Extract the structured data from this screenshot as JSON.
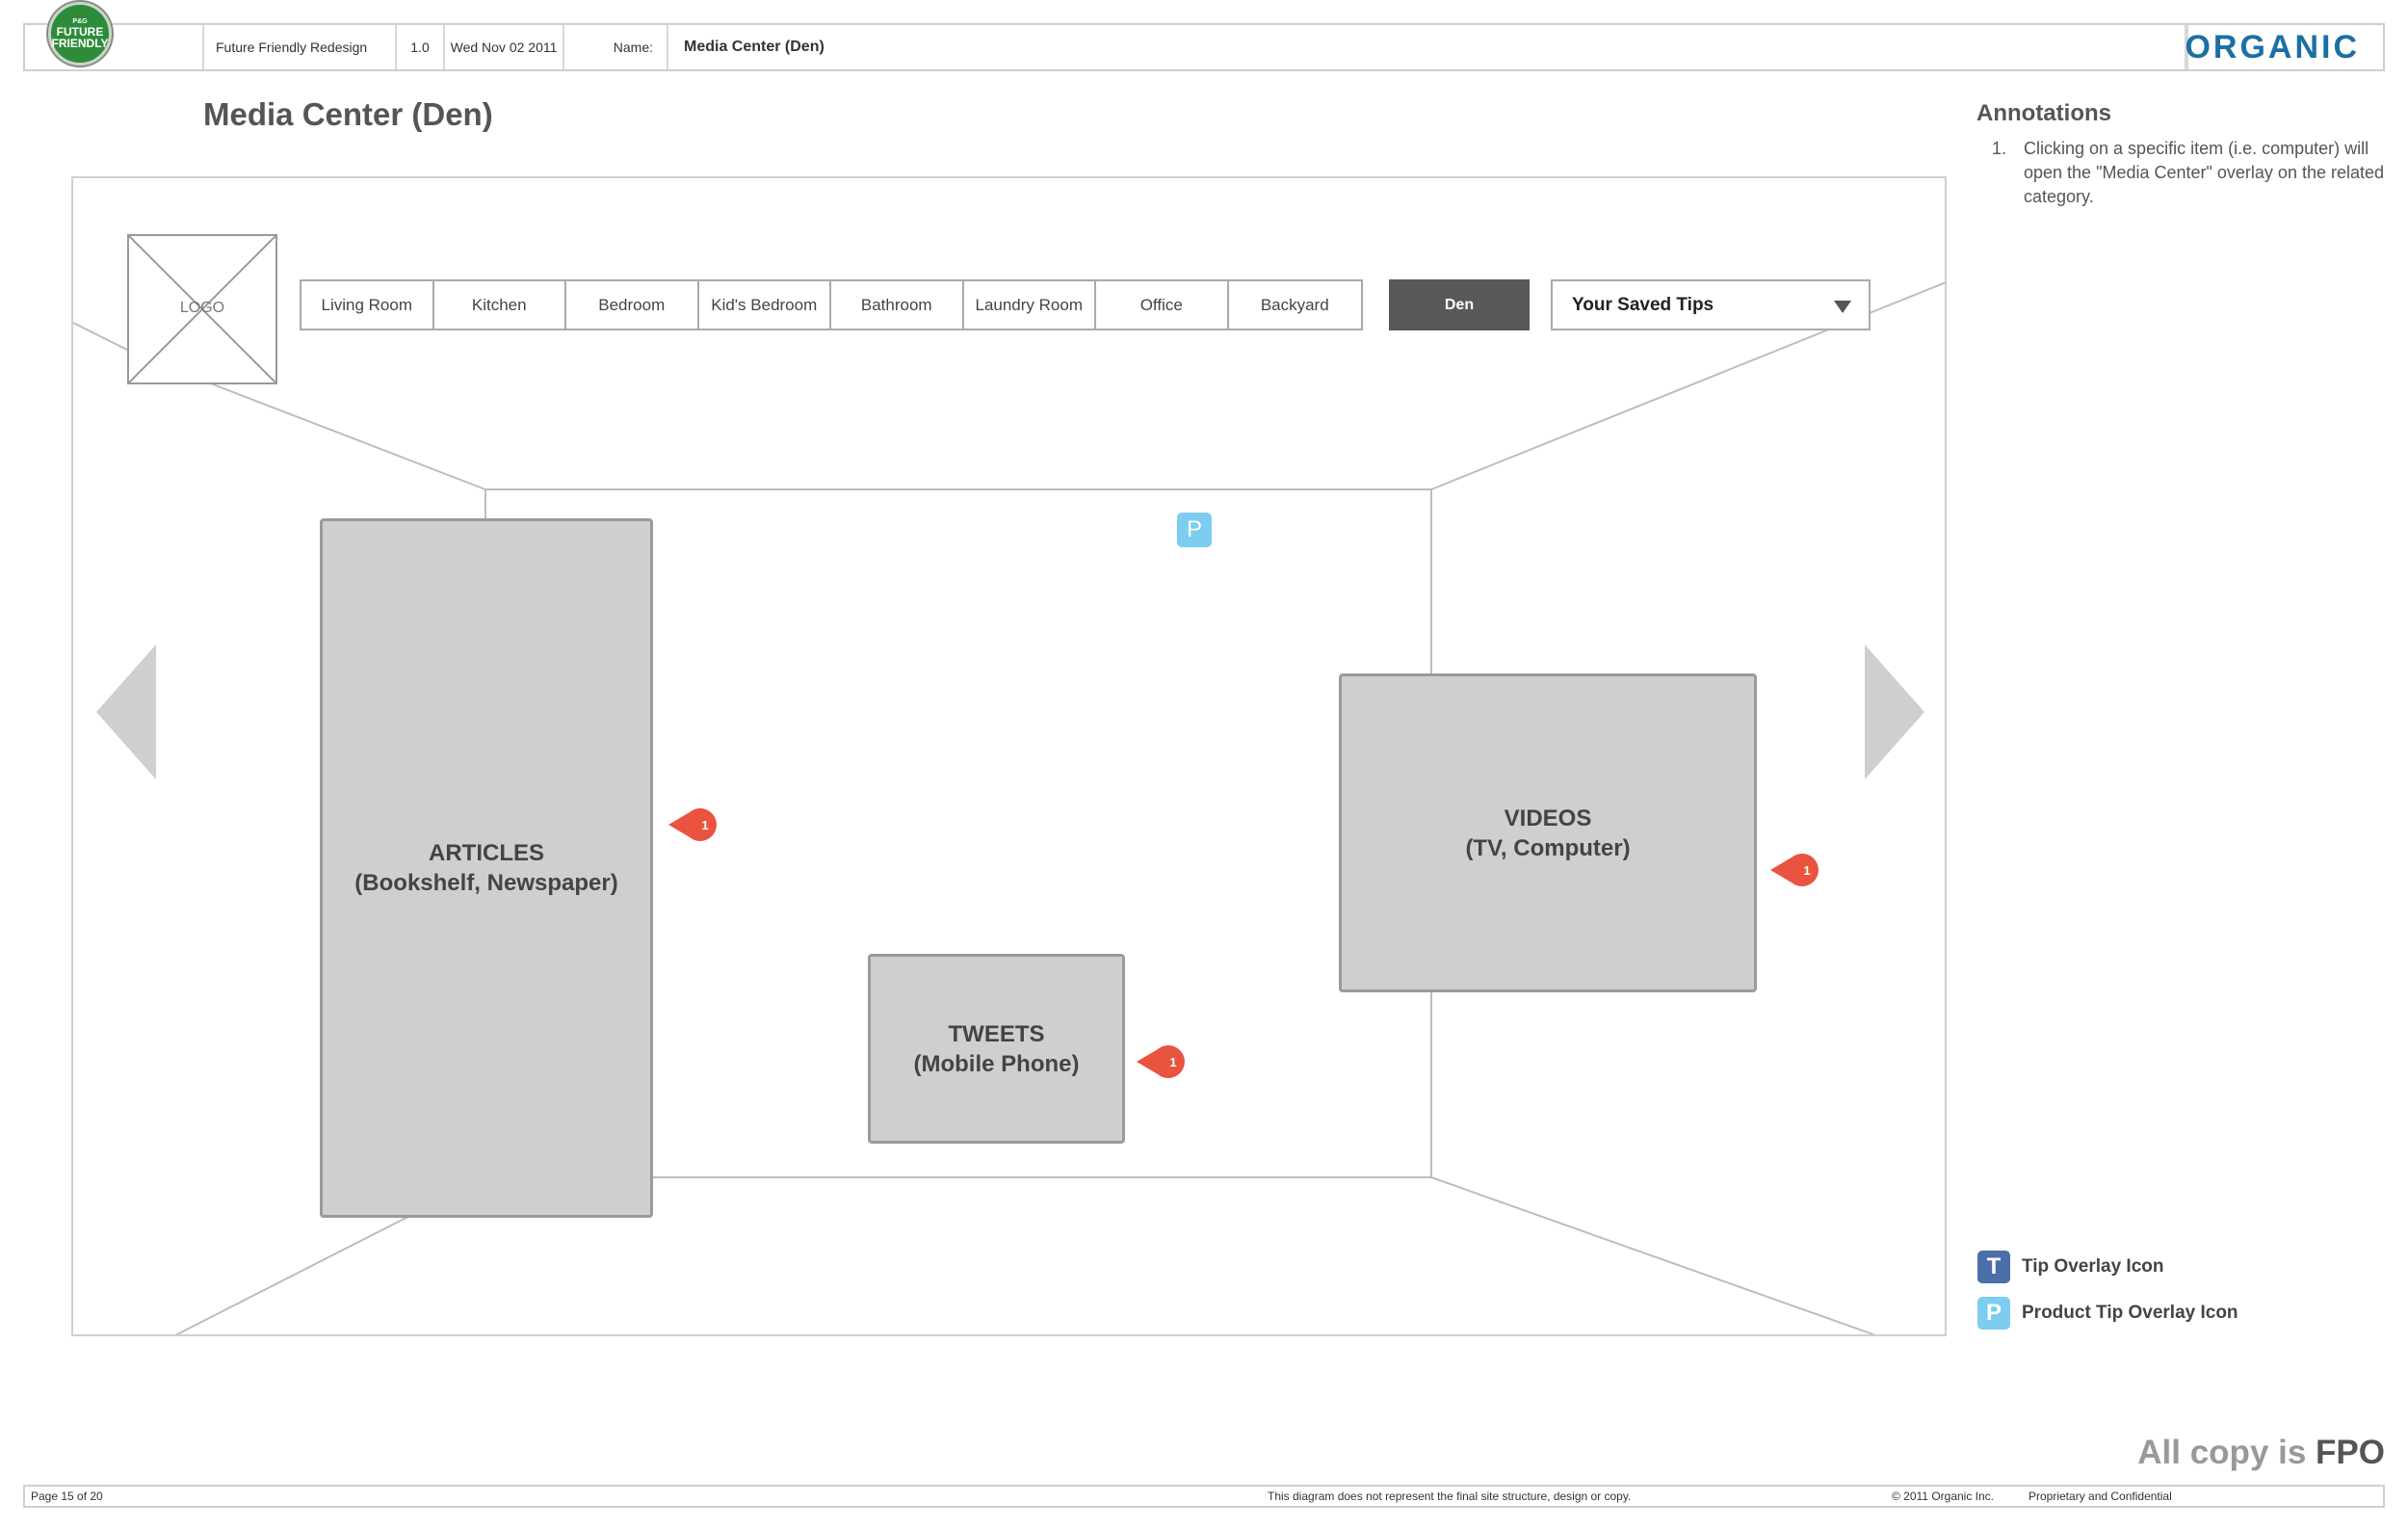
{
  "header": {
    "badge_line1": "P&G",
    "badge_line2": "FUTURE",
    "badge_line3": "FRIENDLY",
    "project": "Future Friendly Redesign",
    "version": "1.0",
    "date": "Wed Nov 02 2011",
    "name_label": "Name:",
    "name_value": "Media Center (Den)",
    "brand": "ORGANIC"
  },
  "page_title": "Media Center (Den)",
  "annotations": {
    "title": "Annotations",
    "items": [
      {
        "num": "1.",
        "text": "Clicking on a specific item (i.e. computer) will open the \"Media Center\" overlay on the related category."
      }
    ]
  },
  "wireframe": {
    "logo_label": "LOGO",
    "tabs": [
      "Living Room",
      "Kitchen",
      "Bedroom",
      "Kid's Bedroom",
      "Bathroom",
      "Laundry Room",
      "Office",
      "Backyard"
    ],
    "active_tab": "Den",
    "saved_tips_label": "Your Saved Tips",
    "product_tip_icon": "P",
    "articles": {
      "line1": "ARTICLES",
      "line2": "(Bookshelf, Newspaper)"
    },
    "videos": {
      "line1": "VIDEOS",
      "line2": "(TV, Computer)"
    },
    "tweets": {
      "line1": "TWEETS",
      "line2": "(Mobile Phone)"
    },
    "pin_label": "1",
    "pin_color": "#e9533f"
  },
  "legend": {
    "tip_icon_letter": "T",
    "tip_label": "Tip Overlay Icon",
    "tip_color": "#4a6ea8",
    "product_icon_letter": "P",
    "product_label": "Product Tip Overlay Icon",
    "product_color": "#7ccdf0"
  },
  "fpo": {
    "prefix": "All copy is ",
    "emphasis": "FPO"
  },
  "footer": {
    "page": "Page 15 of 20",
    "disclaimer": "This diagram does not represent the final site structure, design or copy.",
    "copyright": "© 2011 Organic Inc.",
    "confidential": "Proprietary and Confidential"
  }
}
